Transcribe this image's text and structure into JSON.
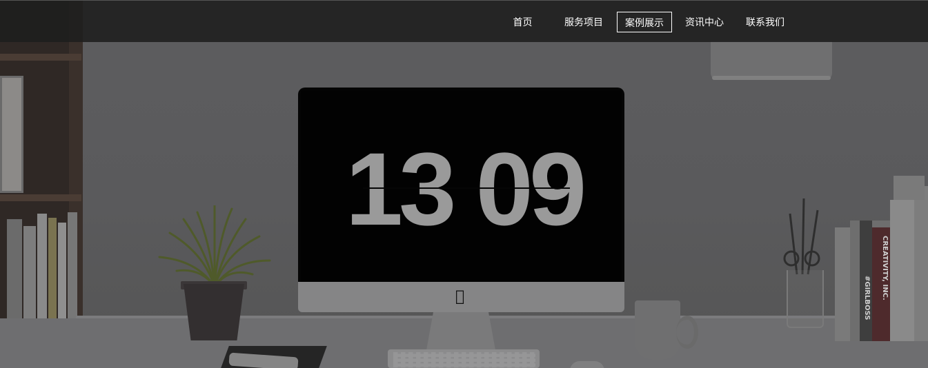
{
  "nav": {
    "items": [
      {
        "label": "首页",
        "active": false
      },
      {
        "label": "服务项目",
        "active": false
      },
      {
        "label": "案例展示",
        "active": true
      },
      {
        "label": "资讯中心",
        "active": false
      },
      {
        "label": "联系我们",
        "active": false
      }
    ]
  },
  "hero": {
    "clock_hours": "13",
    "clock_minutes": "09",
    "overlay_color": "#000000",
    "desk_color": "#6e6e70"
  },
  "book_spines": {
    "creativity": "CREATIVITY, INC.",
    "girlboss": "#GIRLBOSS"
  }
}
